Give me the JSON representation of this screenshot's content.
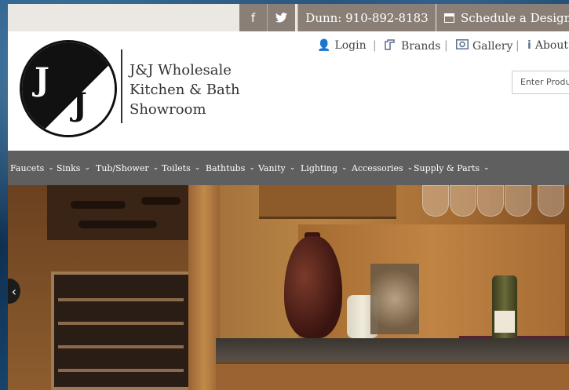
{
  "topbar": {
    "facebook_icon": "f",
    "twitter_icon": "🐦",
    "phone": "Dunn: 910-892-8183",
    "schedule": "Schedule a Design"
  },
  "header": {
    "logo_text": {
      "j1": "J",
      "amp": "&",
      "j2": "J"
    },
    "brand_lines": [
      "J&J Wholesale",
      "Kitchen & Bath",
      "Showroom"
    ],
    "util_links": [
      {
        "label": "Login",
        "icon": "user-icon"
      },
      {
        "label": "Brands",
        "icon": "brands-icon"
      },
      {
        "label": "Gallery",
        "icon": "gallery-icon"
      },
      {
        "label": "About",
        "icon": "info-icon"
      }
    ],
    "search_placeholder": "Enter Product Name"
  },
  "nav": {
    "items": [
      "Faucets",
      "Sinks",
      "Tub/Shower",
      "Toilets",
      "Bathtubs",
      "Vanity",
      "Lighting",
      "Accessories",
      "Supply & Parts"
    ]
  },
  "colors": {
    "topbar_bg": "#ebe7e3",
    "topbar_button": "#8a7f77",
    "nav_bg": "#5f5f60"
  }
}
